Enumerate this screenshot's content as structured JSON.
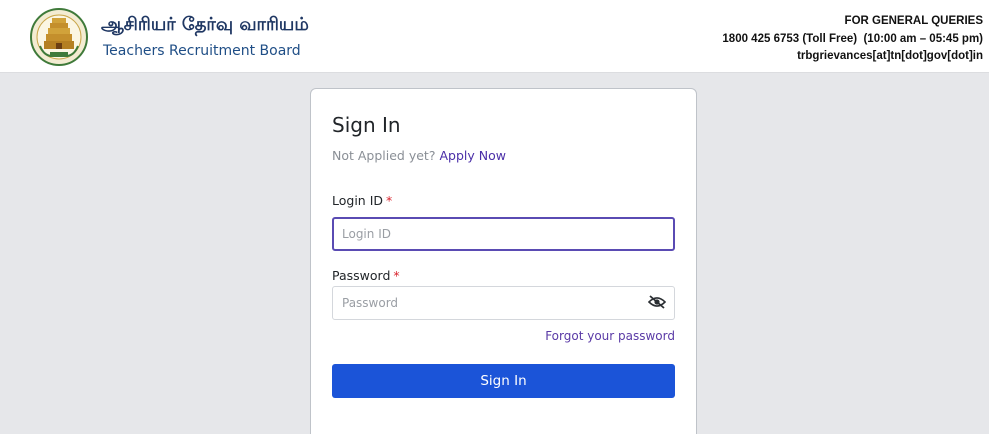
{
  "header": {
    "title_tamil": "ஆசிரியர் தேர்வு வாரியம்",
    "title_english": "Teachers Recruitment Board",
    "queries_heading": "FOR GENERAL QUERIES",
    "phone_line": "1800 425 6753 (Toll Free)  (10:00 am – 05:45 pm)",
    "email_line": "trbgrievances[at]tn[dot]gov[dot]in",
    "emblem_icon": "tamil-nadu-emblem-icon"
  },
  "signin": {
    "title": "Sign In",
    "not_applied_text": "Not Applied yet?",
    "apply_link": "Apply Now",
    "login_id_label": "Login ID",
    "login_id_placeholder": "Login ID",
    "login_id_value": "",
    "password_label": "Password",
    "password_placeholder": "Password",
    "password_value": "",
    "required_marker": "*",
    "toggle_icon": "eye-slash-icon",
    "forgot_link": "Forgot your password",
    "submit_label": "Sign In"
  },
  "colors": {
    "primary_button": "#1b54d8",
    "link": "#4b2fa8",
    "required": "#d9232d",
    "page_background": "#e6e7ea"
  }
}
